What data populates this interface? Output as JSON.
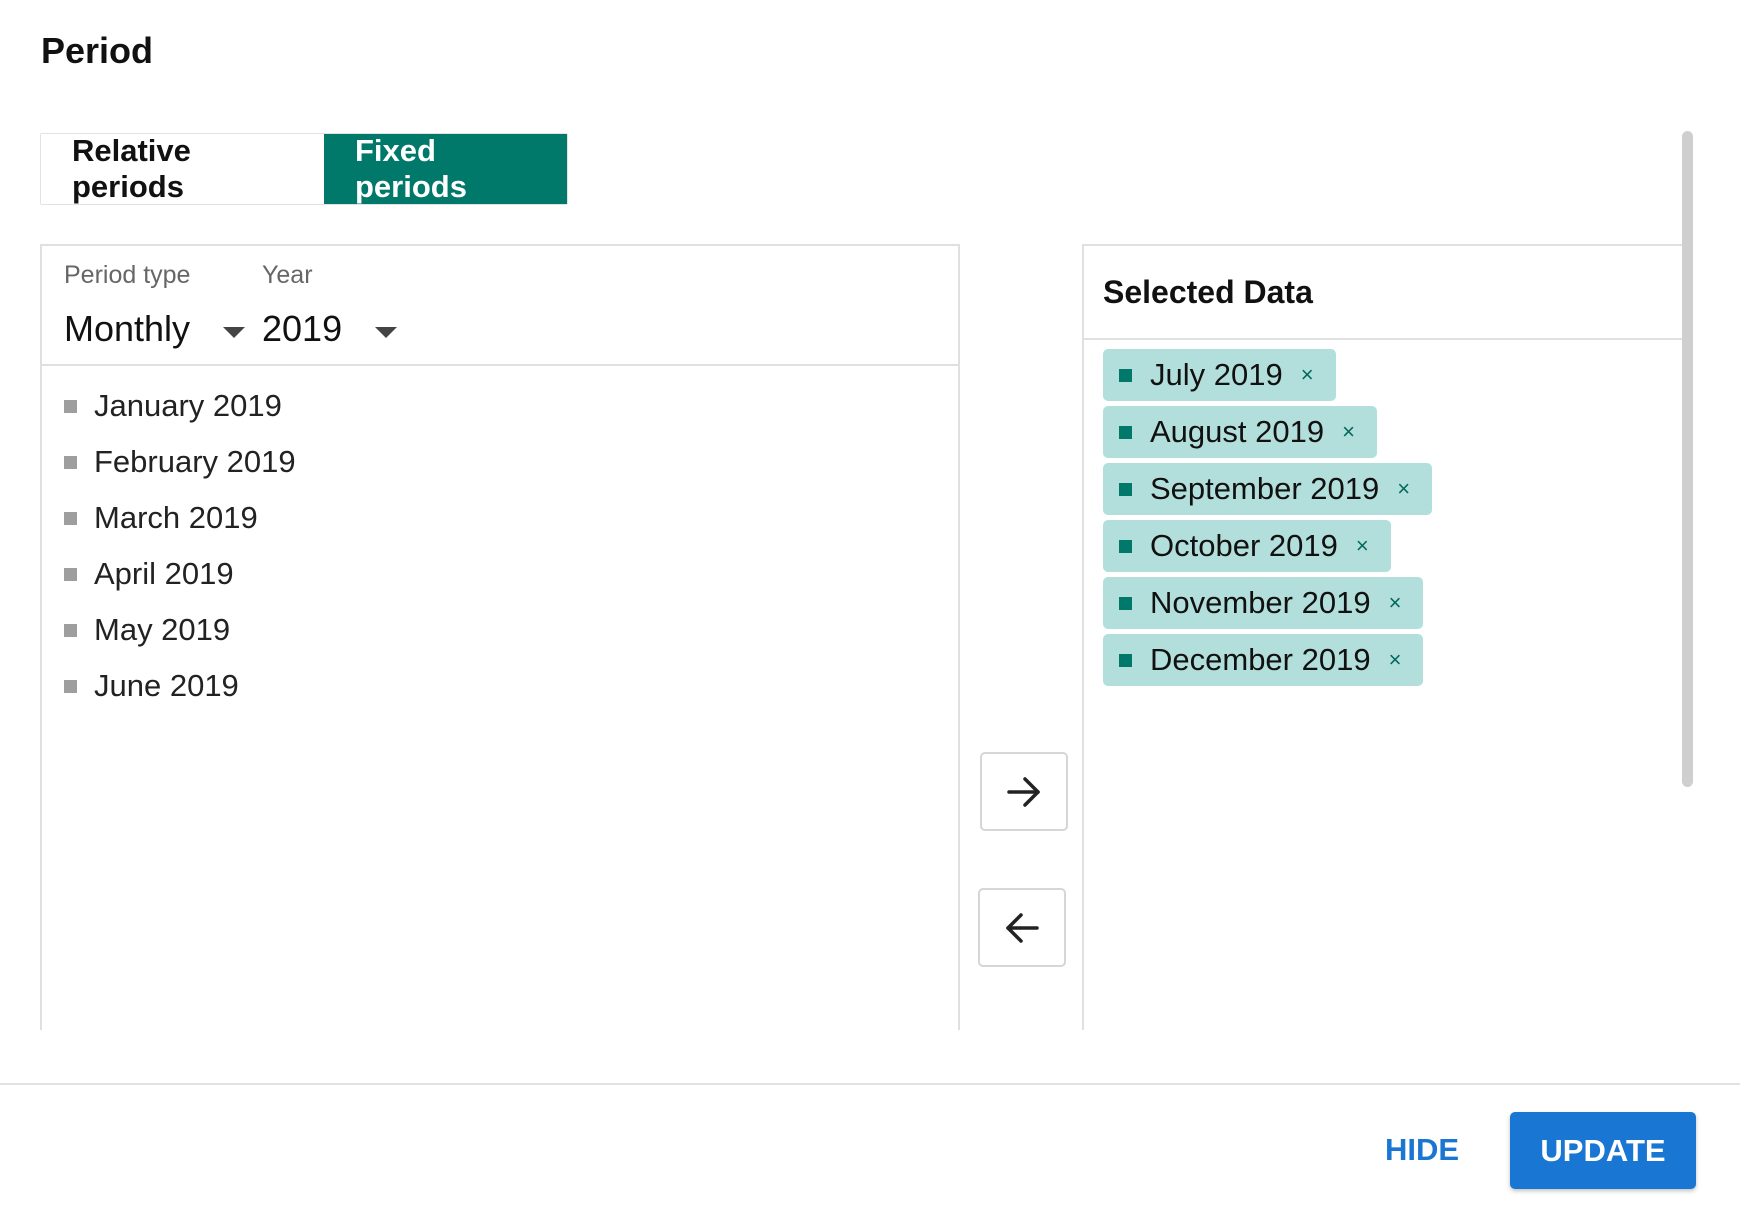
{
  "dialog": {
    "title": "Period"
  },
  "tabs": [
    {
      "label": "Relative periods",
      "active": false
    },
    {
      "label": "Fixed periods",
      "active": true
    }
  ],
  "filters": {
    "period_type": {
      "label": "Period type",
      "value": "Monthly"
    },
    "year": {
      "label": "Year",
      "value": "2019"
    }
  },
  "available": {
    "items": [
      {
        "label": "January 2019"
      },
      {
        "label": "February 2019"
      },
      {
        "label": "March 2019"
      },
      {
        "label": "April 2019"
      },
      {
        "label": "May 2019"
      },
      {
        "label": "June 2019"
      }
    ]
  },
  "transfer": {
    "select_icon": "arrow-right-icon",
    "deselect_icon": "arrow-left-icon"
  },
  "selected": {
    "title": "Selected Data",
    "remove_glyph": "×",
    "items": [
      {
        "label": "July 2019"
      },
      {
        "label": "August 2019"
      },
      {
        "label": "September 2019"
      },
      {
        "label": "October 2019"
      },
      {
        "label": "November 2019"
      },
      {
        "label": "December 2019"
      }
    ]
  },
  "footer": {
    "hide_label": "HIDE",
    "update_label": "UPDATE"
  },
  "colors": {
    "accent_teal": "#00796b",
    "chip_bg": "#b2dfdb",
    "primary_blue": "#1976d2"
  }
}
